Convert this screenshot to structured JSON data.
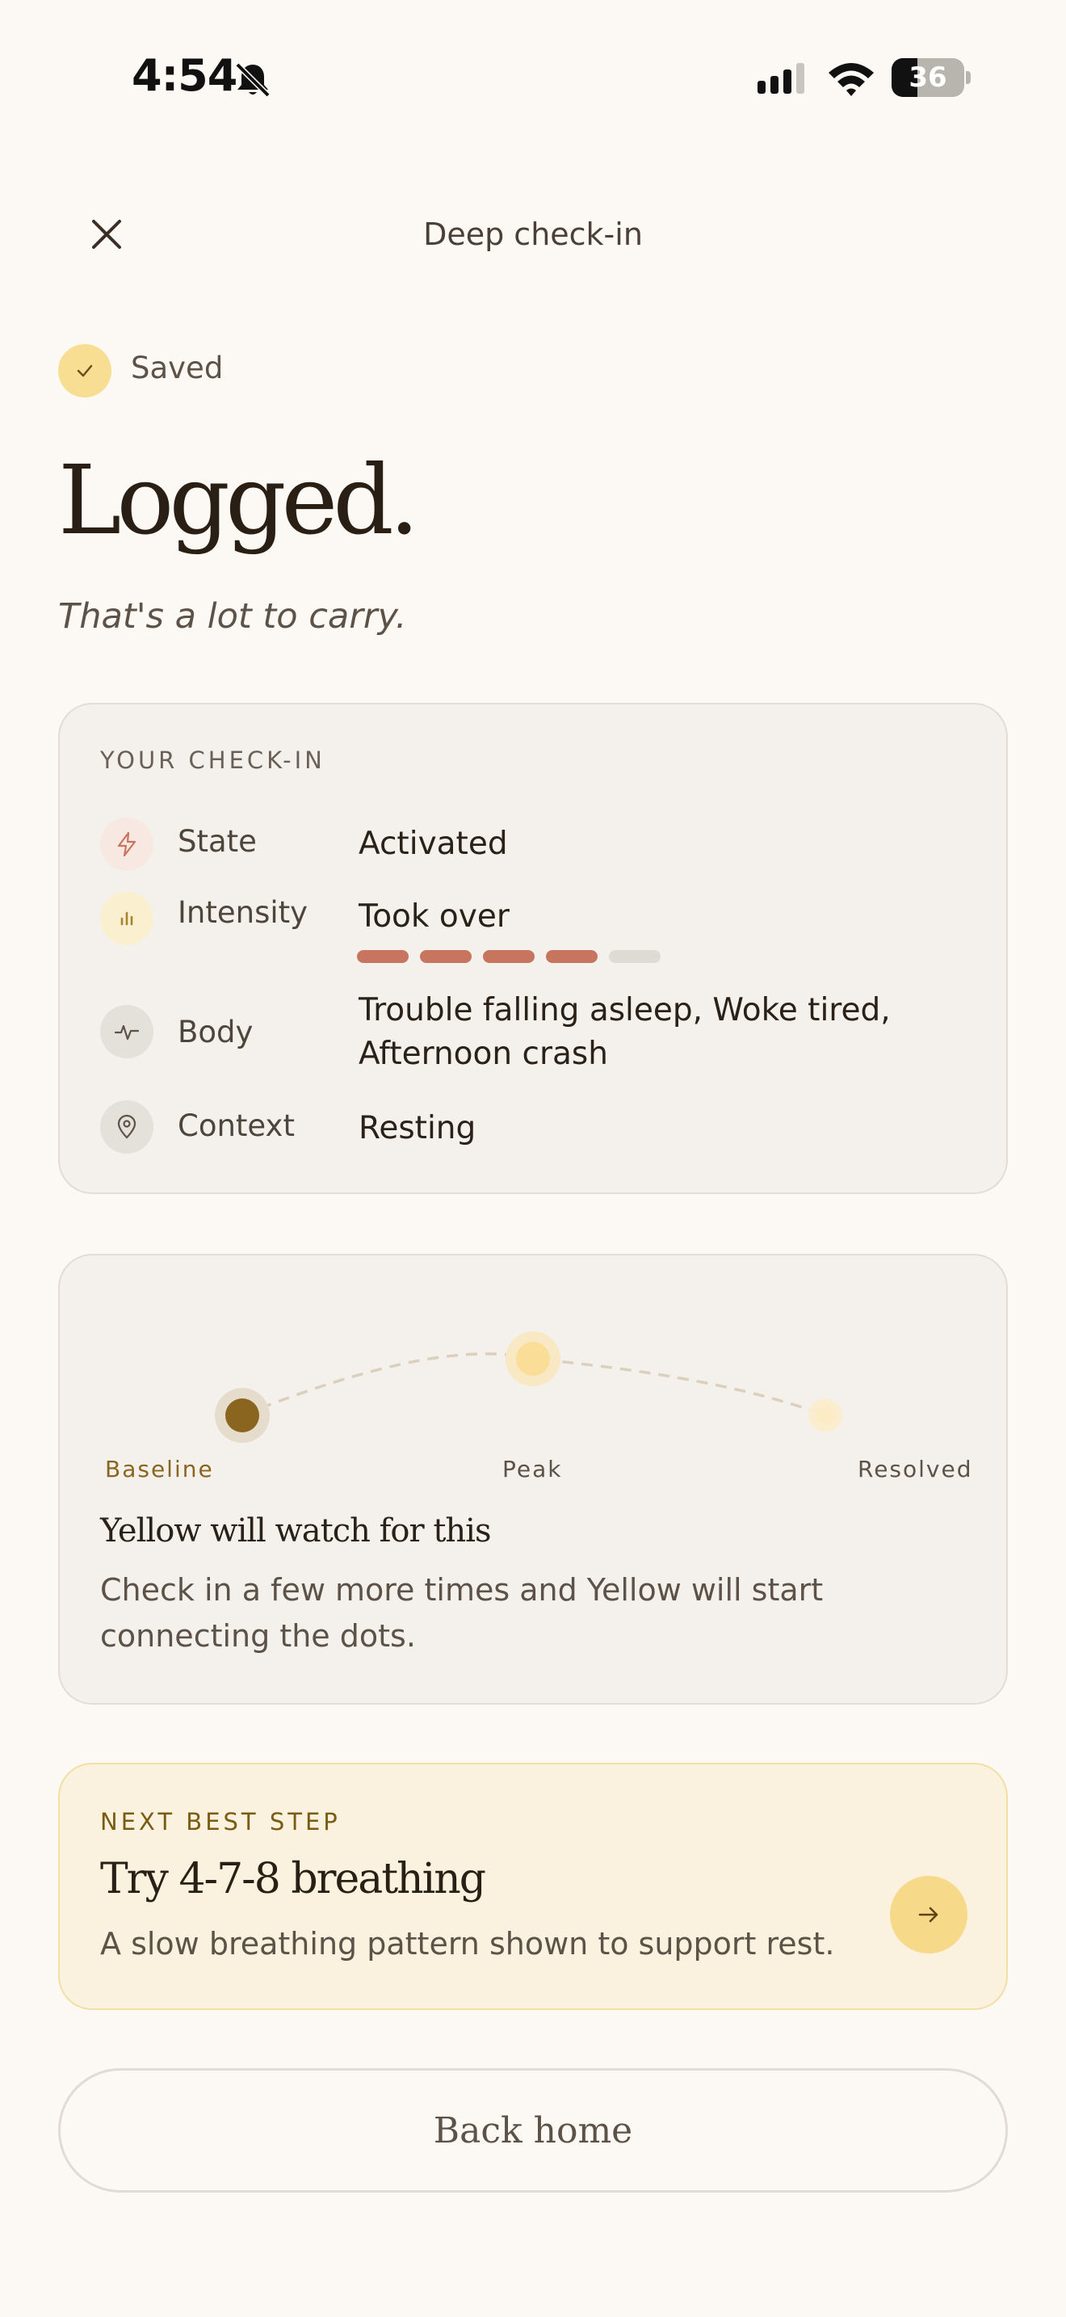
{
  "status_bar": {
    "time": "4:54",
    "battery_percent": "36",
    "battery_level": 0.36
  },
  "header": {
    "title": "Deep check-in",
    "close_icon": "close-icon"
  },
  "saved": {
    "label": "Saved"
  },
  "hero": {
    "title": "Logged.",
    "subtitle": "That's a lot to carry."
  },
  "checkin_card": {
    "heading": "YOUR CHECK-IN",
    "rows": [
      {
        "icon": "bolt-icon",
        "label": "State",
        "value": "Activated"
      },
      {
        "icon": "bar-chart-icon",
        "label": "Intensity",
        "value": "Took over",
        "level": 4,
        "max": 5
      },
      {
        "icon": "pulse-icon",
        "label": "Body",
        "value_line1": "Trouble falling asleep, Woke tired,",
        "value_line2": "Afternoon crash"
      },
      {
        "icon": "location-pin-icon",
        "label": "Context",
        "value": "Resting"
      }
    ],
    "colors": {
      "bar_filled": "#C87560",
      "bar_empty": "#DEDAD4"
    }
  },
  "trend_card": {
    "labels": {
      "baseline": "Baseline",
      "peak": "Peak",
      "resolved": "Resolved"
    },
    "heading": "Yellow will watch for this",
    "body": "Check in a few more times and Yellow will start connecting the dots."
  },
  "next_step": {
    "eyebrow": "NEXT BEST STEP",
    "title": "Try 4-7-8 breathing",
    "body": "A slow breathing pattern shown to support rest.",
    "action_icon": "arrow-right-icon"
  },
  "footer": {
    "back_label": "Back home"
  },
  "colors": {
    "accent_yellow": "#F8DE92",
    "background": "#FCF9F4",
    "baseline_dot": "#8A6520"
  }
}
